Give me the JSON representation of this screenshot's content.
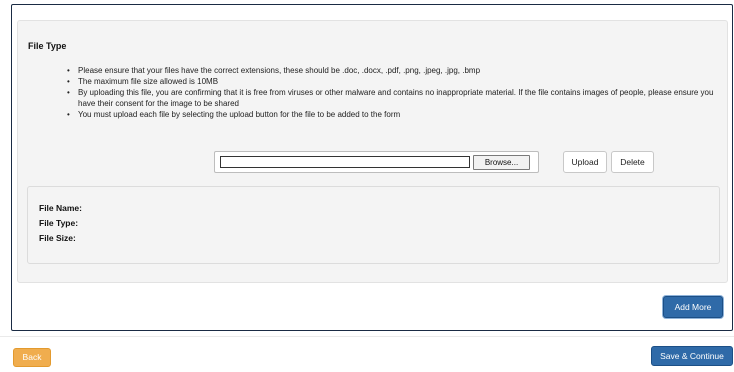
{
  "section": {
    "title": "File Type"
  },
  "rules": [
    "Please ensure that your files have the correct extensions, these should be .doc, .docx, .pdf, .png, .jpeg, .jpg, .bmp",
    "The maximum file size allowed is 10MB",
    "By uploading this file, you are confirming that it is free from viruses or other malware and contains no inappropriate material. If the file contains images of people, please ensure you have their consent for the image to be shared",
    "You must upload each file by selecting the upload button for the file to be added to the form"
  ],
  "file_input": {
    "value": "",
    "browse_label": "Browse..."
  },
  "actions": {
    "upload_label": "Upload",
    "delete_label": "Delete",
    "add_more_label": "Add More"
  },
  "file_info": {
    "name_label": "File Name:",
    "type_label": "File Type:",
    "size_label": "File Size:"
  },
  "footer": {
    "back_label": "Back",
    "save_label": "Save & Continue"
  },
  "colors": {
    "primary": "#2f6aa8",
    "warning": "#f0ad4e",
    "panel": "#f4f4f4"
  }
}
